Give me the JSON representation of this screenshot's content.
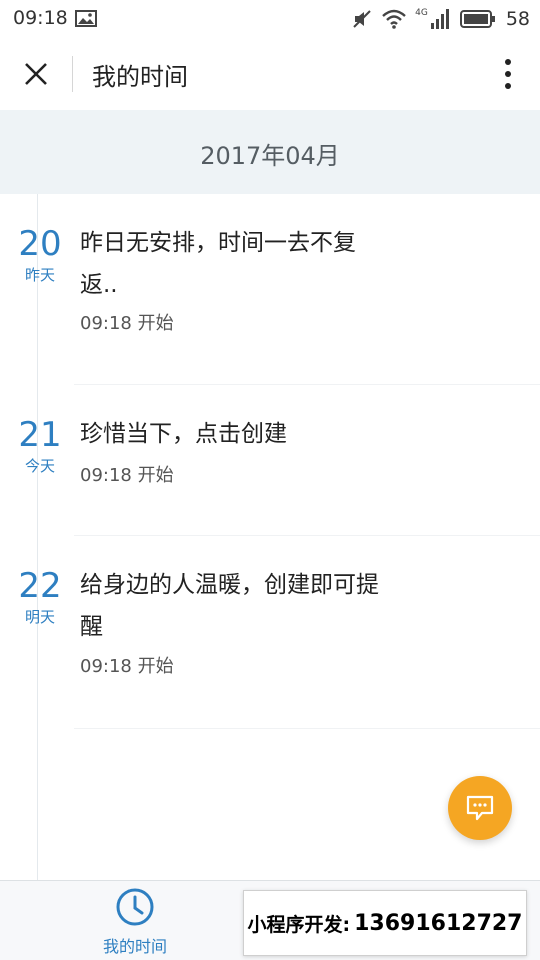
{
  "status_bar": {
    "time": "09:18",
    "network": "4G",
    "battery": "58",
    "icons": [
      "image-icon",
      "mute-icon",
      "wifi-icon",
      "signal-icon",
      "battery-icon"
    ]
  },
  "header": {
    "title": "我的时间",
    "close_icon": "close-icon",
    "more_icon": "more-vertical-icon"
  },
  "month": "2017年04月",
  "days": [
    {
      "date": "20",
      "relative": "昨天",
      "text": "昨日无安排，时间一去不复返..",
      "meta": "09:18 开始"
    },
    {
      "date": "21",
      "relative": "今天",
      "text": "珍惜当下，点击创建",
      "meta": "09:18 开始"
    },
    {
      "date": "22",
      "relative": "明天",
      "text": "给身边的人温暖，创建即可提醒",
      "meta": "09:18 开始"
    }
  ],
  "fab_icon": "chat-icon",
  "tab_bar": {
    "home_label": "我的时间",
    "home_icon": "clock-icon"
  },
  "banner": {
    "label": "小程序开发:",
    "phone": "13691612727"
  },
  "colors": {
    "accent": "#2e7fc1",
    "fab": "#f5a623",
    "month_band": "#eef3f6"
  }
}
